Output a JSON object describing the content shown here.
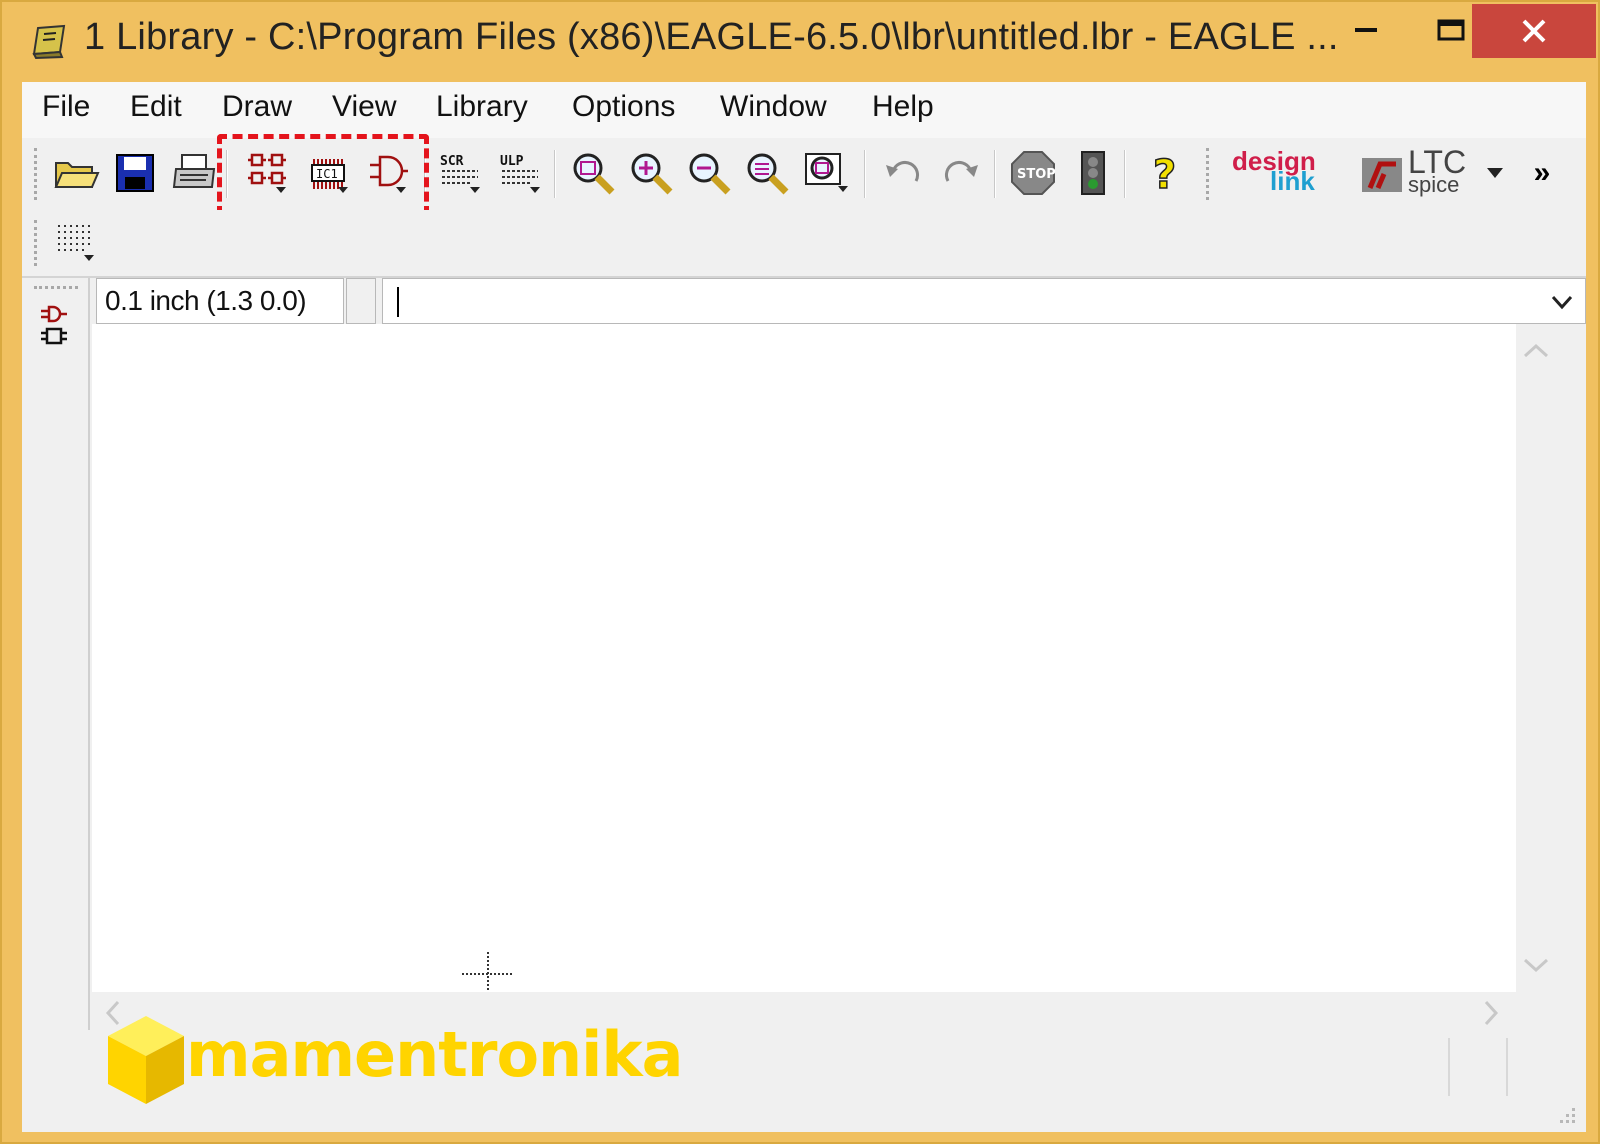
{
  "window": {
    "title": "1 Library - C:\\Program Files (x86)\\EAGLE-6.5.0\\lbr\\untitled.lbr - EAGLE ...",
    "frame_color": "#f0c060",
    "close_color": "#c9463d"
  },
  "menu": {
    "items": [
      "File",
      "Edit",
      "Draw",
      "View",
      "Library",
      "Options",
      "Window",
      "Help"
    ]
  },
  "toolbar": {
    "buttons": [
      {
        "name": "open-icon"
      },
      {
        "name": "save-icon"
      },
      {
        "name": "print-icon"
      },
      {
        "name": "device-icon"
      },
      {
        "name": "package-icon"
      },
      {
        "name": "symbol-icon"
      },
      {
        "name": "script-icon"
      },
      {
        "name": "ulp-icon"
      },
      {
        "name": "zoom-fit-icon"
      },
      {
        "name": "zoom-in-icon"
      },
      {
        "name": "zoom-out-icon"
      },
      {
        "name": "redraw-icon"
      },
      {
        "name": "zoom-select-icon"
      },
      {
        "name": "undo-icon"
      },
      {
        "name": "redo-icon"
      },
      {
        "name": "stop-icon"
      },
      {
        "name": "go-icon"
      },
      {
        "name": "help-icon"
      }
    ],
    "highlight_color": "#e4141c",
    "designlink": {
      "part1": "design",
      "part2": "link"
    },
    "ltc": {
      "line1": "LTC",
      "line2": "spice"
    },
    "overflow": "»"
  },
  "toolbar2": {
    "grid_icon": "grid-icon"
  },
  "coordinates": {
    "value": "0.1 inch (1.3 0.0)"
  },
  "command": {
    "value": ""
  },
  "brand": {
    "text": "mamentronika",
    "color": "#ffd400"
  }
}
